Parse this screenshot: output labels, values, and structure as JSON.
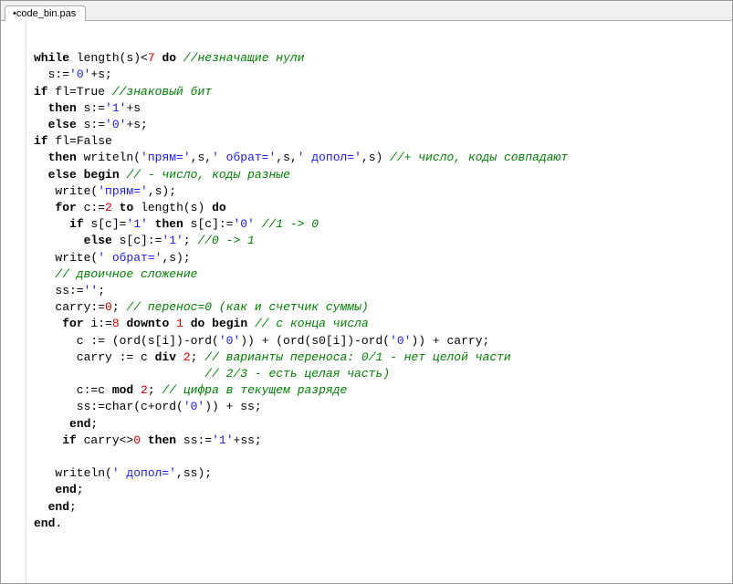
{
  "tab": {
    "label": "•code_bin.pas"
  },
  "code": {
    "lines": [
      [],
      [
        [
          "kw",
          "while"
        ],
        [
          "id",
          " length(s)<"
        ],
        [
          "num",
          "7"
        ],
        [
          "id",
          " "
        ],
        [
          "kw",
          "do"
        ],
        [
          "id",
          " "
        ],
        [
          "cm",
          "//незначащие нули"
        ]
      ],
      [
        [
          "id",
          "  s:="
        ],
        [
          "str",
          "'0'"
        ],
        [
          "id",
          "+s;"
        ]
      ],
      [
        [
          "kw",
          "if"
        ],
        [
          "id",
          " fl=True "
        ],
        [
          "cm",
          "//знаковый бит"
        ]
      ],
      [
        [
          "id",
          "  "
        ],
        [
          "kw",
          "then"
        ],
        [
          "id",
          " s:="
        ],
        [
          "str",
          "'1'"
        ],
        [
          "id",
          "+s"
        ]
      ],
      [
        [
          "id",
          "  "
        ],
        [
          "kw",
          "else"
        ],
        [
          "id",
          " s:="
        ],
        [
          "str",
          "'0'"
        ],
        [
          "id",
          "+s;"
        ]
      ],
      [
        [
          "kw",
          "if"
        ],
        [
          "id",
          " fl=False"
        ]
      ],
      [
        [
          "id",
          "  "
        ],
        [
          "kw",
          "then"
        ],
        [
          "id",
          " writeln("
        ],
        [
          "str",
          "'прям='"
        ],
        [
          "id",
          ",s,"
        ],
        [
          "str",
          "' обрат='"
        ],
        [
          "id",
          ",s,"
        ],
        [
          "str",
          "' допол='"
        ],
        [
          "id",
          ",s) "
        ],
        [
          "cm",
          "//+ число, коды совпадают"
        ]
      ],
      [
        [
          "id",
          "  "
        ],
        [
          "kw",
          "else"
        ],
        [
          "id",
          " "
        ],
        [
          "kw",
          "begin"
        ],
        [
          "id",
          " "
        ],
        [
          "cm",
          "// - число, коды разные"
        ]
      ],
      [
        [
          "id",
          "   write("
        ],
        [
          "str",
          "'прям='"
        ],
        [
          "id",
          ",s);"
        ]
      ],
      [
        [
          "id",
          "   "
        ],
        [
          "kw",
          "for"
        ],
        [
          "id",
          " c:="
        ],
        [
          "num",
          "2"
        ],
        [
          "id",
          " "
        ],
        [
          "kw",
          "to"
        ],
        [
          "id",
          " length(s) "
        ],
        [
          "kw",
          "do"
        ]
      ],
      [
        [
          "id",
          "     "
        ],
        [
          "kw",
          "if"
        ],
        [
          "id",
          " s[c]="
        ],
        [
          "str",
          "'1'"
        ],
        [
          "id",
          " "
        ],
        [
          "kw",
          "then"
        ],
        [
          "id",
          " s[c]:="
        ],
        [
          "str",
          "'0'"
        ],
        [
          "id",
          " "
        ],
        [
          "cm",
          "//1 -> 0"
        ]
      ],
      [
        [
          "id",
          "       "
        ],
        [
          "kw",
          "else"
        ],
        [
          "id",
          " s[c]:="
        ],
        [
          "str",
          "'1'"
        ],
        [
          "id",
          "; "
        ],
        [
          "cm",
          "//0 -> 1"
        ]
      ],
      [
        [
          "id",
          "   write("
        ],
        [
          "str",
          "' обрат='"
        ],
        [
          "id",
          ",s);"
        ]
      ],
      [
        [
          "id",
          "   "
        ],
        [
          "cm",
          "// двоичное сложение"
        ]
      ],
      [
        [
          "id",
          "   ss:="
        ],
        [
          "str",
          "''"
        ],
        [
          "id",
          ";"
        ]
      ],
      [
        [
          "id",
          "   carry:="
        ],
        [
          "num",
          "0"
        ],
        [
          "id",
          "; "
        ],
        [
          "cm",
          "// перенос=0 (как и счетчик суммы)"
        ]
      ],
      [
        [
          "id",
          "    "
        ],
        [
          "kw",
          "for"
        ],
        [
          "id",
          " i:="
        ],
        [
          "num",
          "8"
        ],
        [
          "id",
          " "
        ],
        [
          "kw",
          "downto"
        ],
        [
          "id",
          " "
        ],
        [
          "num",
          "1"
        ],
        [
          "id",
          " "
        ],
        [
          "kw",
          "do"
        ],
        [
          "id",
          " "
        ],
        [
          "kw",
          "begin"
        ],
        [
          "id",
          " "
        ],
        [
          "cm",
          "// с конца числа"
        ]
      ],
      [
        [
          "id",
          "      c := (ord(s[i])-ord("
        ],
        [
          "str",
          "'0'"
        ],
        [
          "id",
          ")) + (ord(s0[i])-ord("
        ],
        [
          "str",
          "'0'"
        ],
        [
          "id",
          ")) + carry;"
        ]
      ],
      [
        [
          "id",
          "      carry := c "
        ],
        [
          "kw",
          "div"
        ],
        [
          "id",
          " "
        ],
        [
          "num",
          "2"
        ],
        [
          "id",
          "; "
        ],
        [
          "cm",
          "// варианты переноса: 0/1 - нет целой части"
        ]
      ],
      [
        [
          "id",
          "                        "
        ],
        [
          "cm",
          "// 2/3 - есть целая часть)"
        ]
      ],
      [
        [
          "id",
          "      c:=c "
        ],
        [
          "kw",
          "mod"
        ],
        [
          "id",
          " "
        ],
        [
          "num",
          "2"
        ],
        [
          "id",
          "; "
        ],
        [
          "cm",
          "// цифра в текущем разряде"
        ]
      ],
      [
        [
          "id",
          "      ss:=char(c+ord("
        ],
        [
          "str",
          "'0'"
        ],
        [
          "id",
          ")) + ss;"
        ]
      ],
      [
        [
          "id",
          "     "
        ],
        [
          "kw",
          "end"
        ],
        [
          "id",
          ";"
        ]
      ],
      [
        [
          "id",
          "    "
        ],
        [
          "kw",
          "if"
        ],
        [
          "id",
          " carry<>"
        ],
        [
          "num",
          "0"
        ],
        [
          "id",
          " "
        ],
        [
          "kw",
          "then"
        ],
        [
          "id",
          " ss:="
        ],
        [
          "str",
          "'1'"
        ],
        [
          "id",
          "+ss;"
        ]
      ],
      [],
      [
        [
          "id",
          "   writeln("
        ],
        [
          "str",
          "' допол='"
        ],
        [
          "id",
          ",ss);"
        ]
      ],
      [
        [
          "id",
          "   "
        ],
        [
          "kw",
          "end"
        ],
        [
          "id",
          ";"
        ]
      ],
      [
        [
          "id",
          "  "
        ],
        [
          "kw",
          "end"
        ],
        [
          "id",
          ";"
        ]
      ],
      [
        [
          "kw",
          "end"
        ],
        [
          "id",
          "."
        ]
      ]
    ]
  }
}
